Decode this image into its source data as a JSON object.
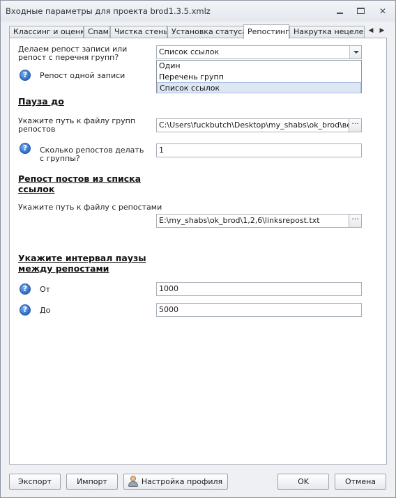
{
  "window": {
    "title": "Входные параметры для проекта brod1.3.5.xmlz"
  },
  "tabs": [
    {
      "label": "Классинг и оценки"
    },
    {
      "label": "Спам"
    },
    {
      "label": "Чистка стены"
    },
    {
      "label": "Установка статуса"
    },
    {
      "label": "Репостинг"
    },
    {
      "label": "Накрутка нецелевы"
    }
  ],
  "icons": {
    "minimize": "minimize-icon",
    "maximize": "maximize-icon",
    "close": "close-icon",
    "help_glyph": "?",
    "ellipsis_glyph": "···",
    "tab_left_glyph": "◀",
    "tab_right_glyph": "▶",
    "close_glyph": "✕"
  },
  "form": {
    "repost_mode_label": "Делаем репост записи или репост с перечня групп?",
    "repost_mode_value": "Список ссылок",
    "repost_mode_options": [
      "Один",
      "Перечень групп",
      "Список ссылок"
    ],
    "single_post_label": "Репост одной записи",
    "pause_heading": "Пауза до",
    "group_file_label": "Укажите путь к файлу групп репостов",
    "group_file_value": "C:\\Users\\fuckbutch\\Desktop\\my_shabs\\ok_brod\\версия",
    "repost_count_label": "Сколько репостов делать с группы?",
    "repost_count_value": "1",
    "list_heading": "Репост постов из списка ссылок",
    "repost_file_label": "Укажите путь к файлу с репостами",
    "repost_file_value": "E:\\my_shabs\\ok_brod\\1,2,6\\linksrepost.txt",
    "interval_heading": "Укажите интервал паузы между репостами",
    "from_label": "От",
    "from_value": "1000",
    "to_label": "До",
    "to_value": "5000"
  },
  "footer": {
    "export_label": "Экспорт",
    "import_label": "Импорт",
    "profile_label": "Настройка профиля",
    "ok_label": "OK",
    "cancel_label": "Отмена"
  }
}
